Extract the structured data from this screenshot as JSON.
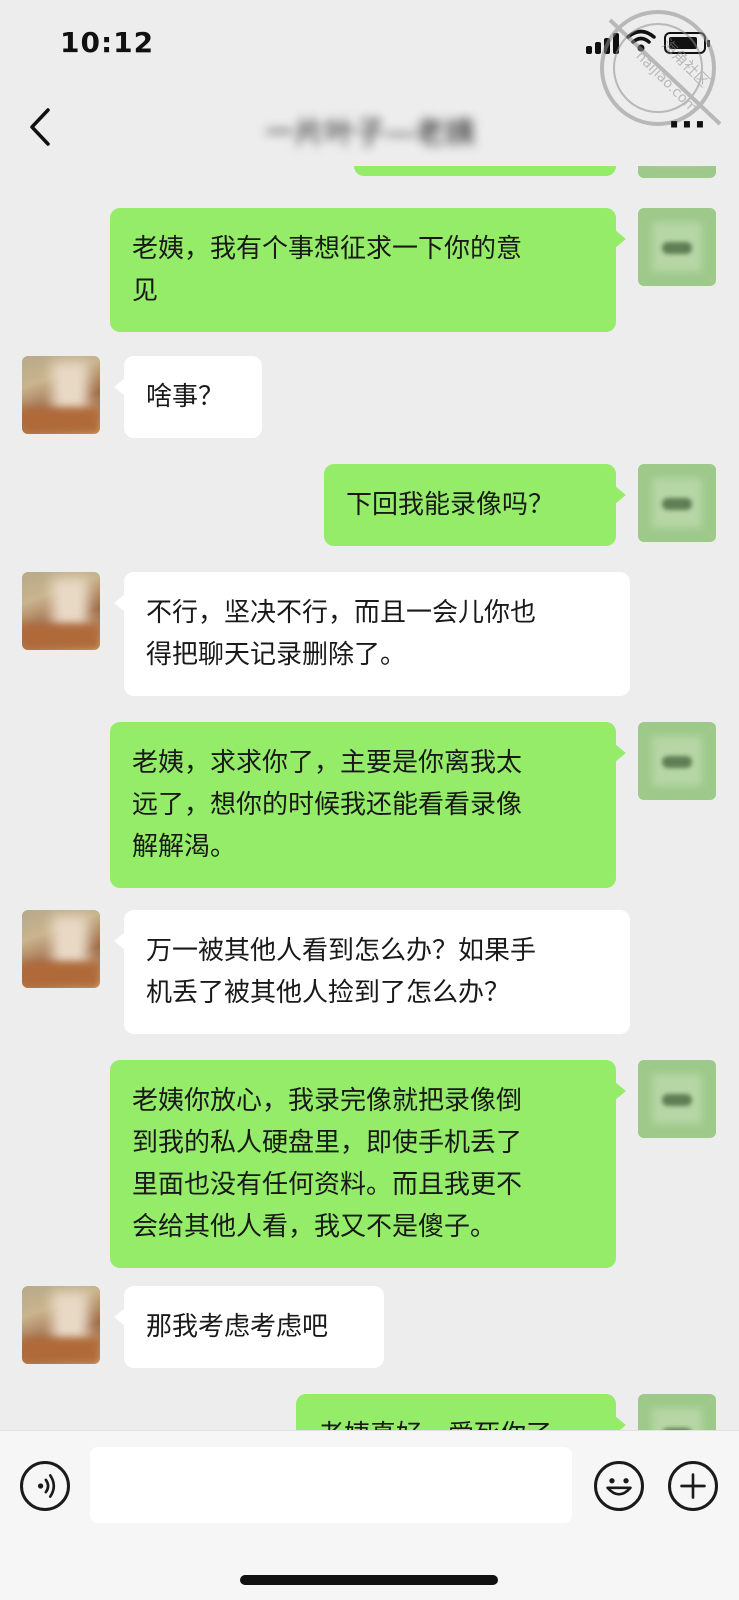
{
  "status_bar": {
    "time": "10:12",
    "icons": [
      "signal-icon",
      "wifi-icon",
      "battery-icon"
    ]
  },
  "watermark": {
    "text": "haijiao.com",
    "text_cn": "海角社区",
    "color": "#9a9a9a"
  },
  "nav": {
    "title": "一片叶子—老姨",
    "back_icon": "chevron-left-icon",
    "more_icon": "more-dots-icon",
    "more_label": "···"
  },
  "colors": {
    "background": "#ededed",
    "outgoing_bubble": "#95ec69",
    "incoming_bubble": "#ffffff",
    "text": "#191919"
  },
  "messages": [
    {
      "sender": "me",
      "text": "老姨，我有个事想征求一下你的意见",
      "lines": [
        "老姨，我有个事想征求一下你的意",
        "见"
      ]
    },
    {
      "sender": "her",
      "text": "啥事？",
      "lines": [
        "啥事？"
      ]
    },
    {
      "sender": "me",
      "text": "下回我能录像吗？",
      "lines": [
        "下回我能录像吗？"
      ]
    },
    {
      "sender": "her",
      "text": "不行，坚决不行，而且一会儿你也得把聊天记录删除了。",
      "lines": [
        "不行，坚决不行，而且一会儿你也",
        "得把聊天记录删除了。"
      ]
    },
    {
      "sender": "me",
      "text": "老姨，求求你了，主要是你离我太远了，想你的时候我还能看看录像解解渴。",
      "lines": [
        "老姨，求求你了，主要是你离我太",
        "远了，想你的时候我还能看看录像",
        "解解渴。"
      ]
    },
    {
      "sender": "her",
      "text": "万一被其他人看到怎么办？如果手机丢了被其他人捡到了怎么办？",
      "lines": [
        "万一被其他人看到怎么办？如果手",
        "机丢了被其他人捡到了怎么办？"
      ]
    },
    {
      "sender": "me",
      "text": "老姨你放心，我录完像就把录像倒到我的私人硬盘里，即使手机丢了里面也没有任何资料。而且我更不会给其他人看，我又不是傻子。",
      "lines": [
        "老姨你放心，我录完像就把录像倒",
        "到我的私人硬盘里，即使手机丢了",
        "里面也没有任何资料。而且我更不",
        "会给其他人看，我又不是傻子。"
      ]
    },
    {
      "sender": "her",
      "text": "那我考虑考虑吧",
      "lines": [
        "那我考虑考虑吧"
      ]
    },
    {
      "sender": "me",
      "text": "老姨真好，爱死你了",
      "lines": [
        "老姨真好，爱死你了"
      ]
    }
  ],
  "input_bar": {
    "voice_icon": "voice-icon",
    "emoji_icon": "emoji-icon",
    "plus_icon": "plus-icon",
    "input_value": "",
    "input_placeholder": ""
  }
}
